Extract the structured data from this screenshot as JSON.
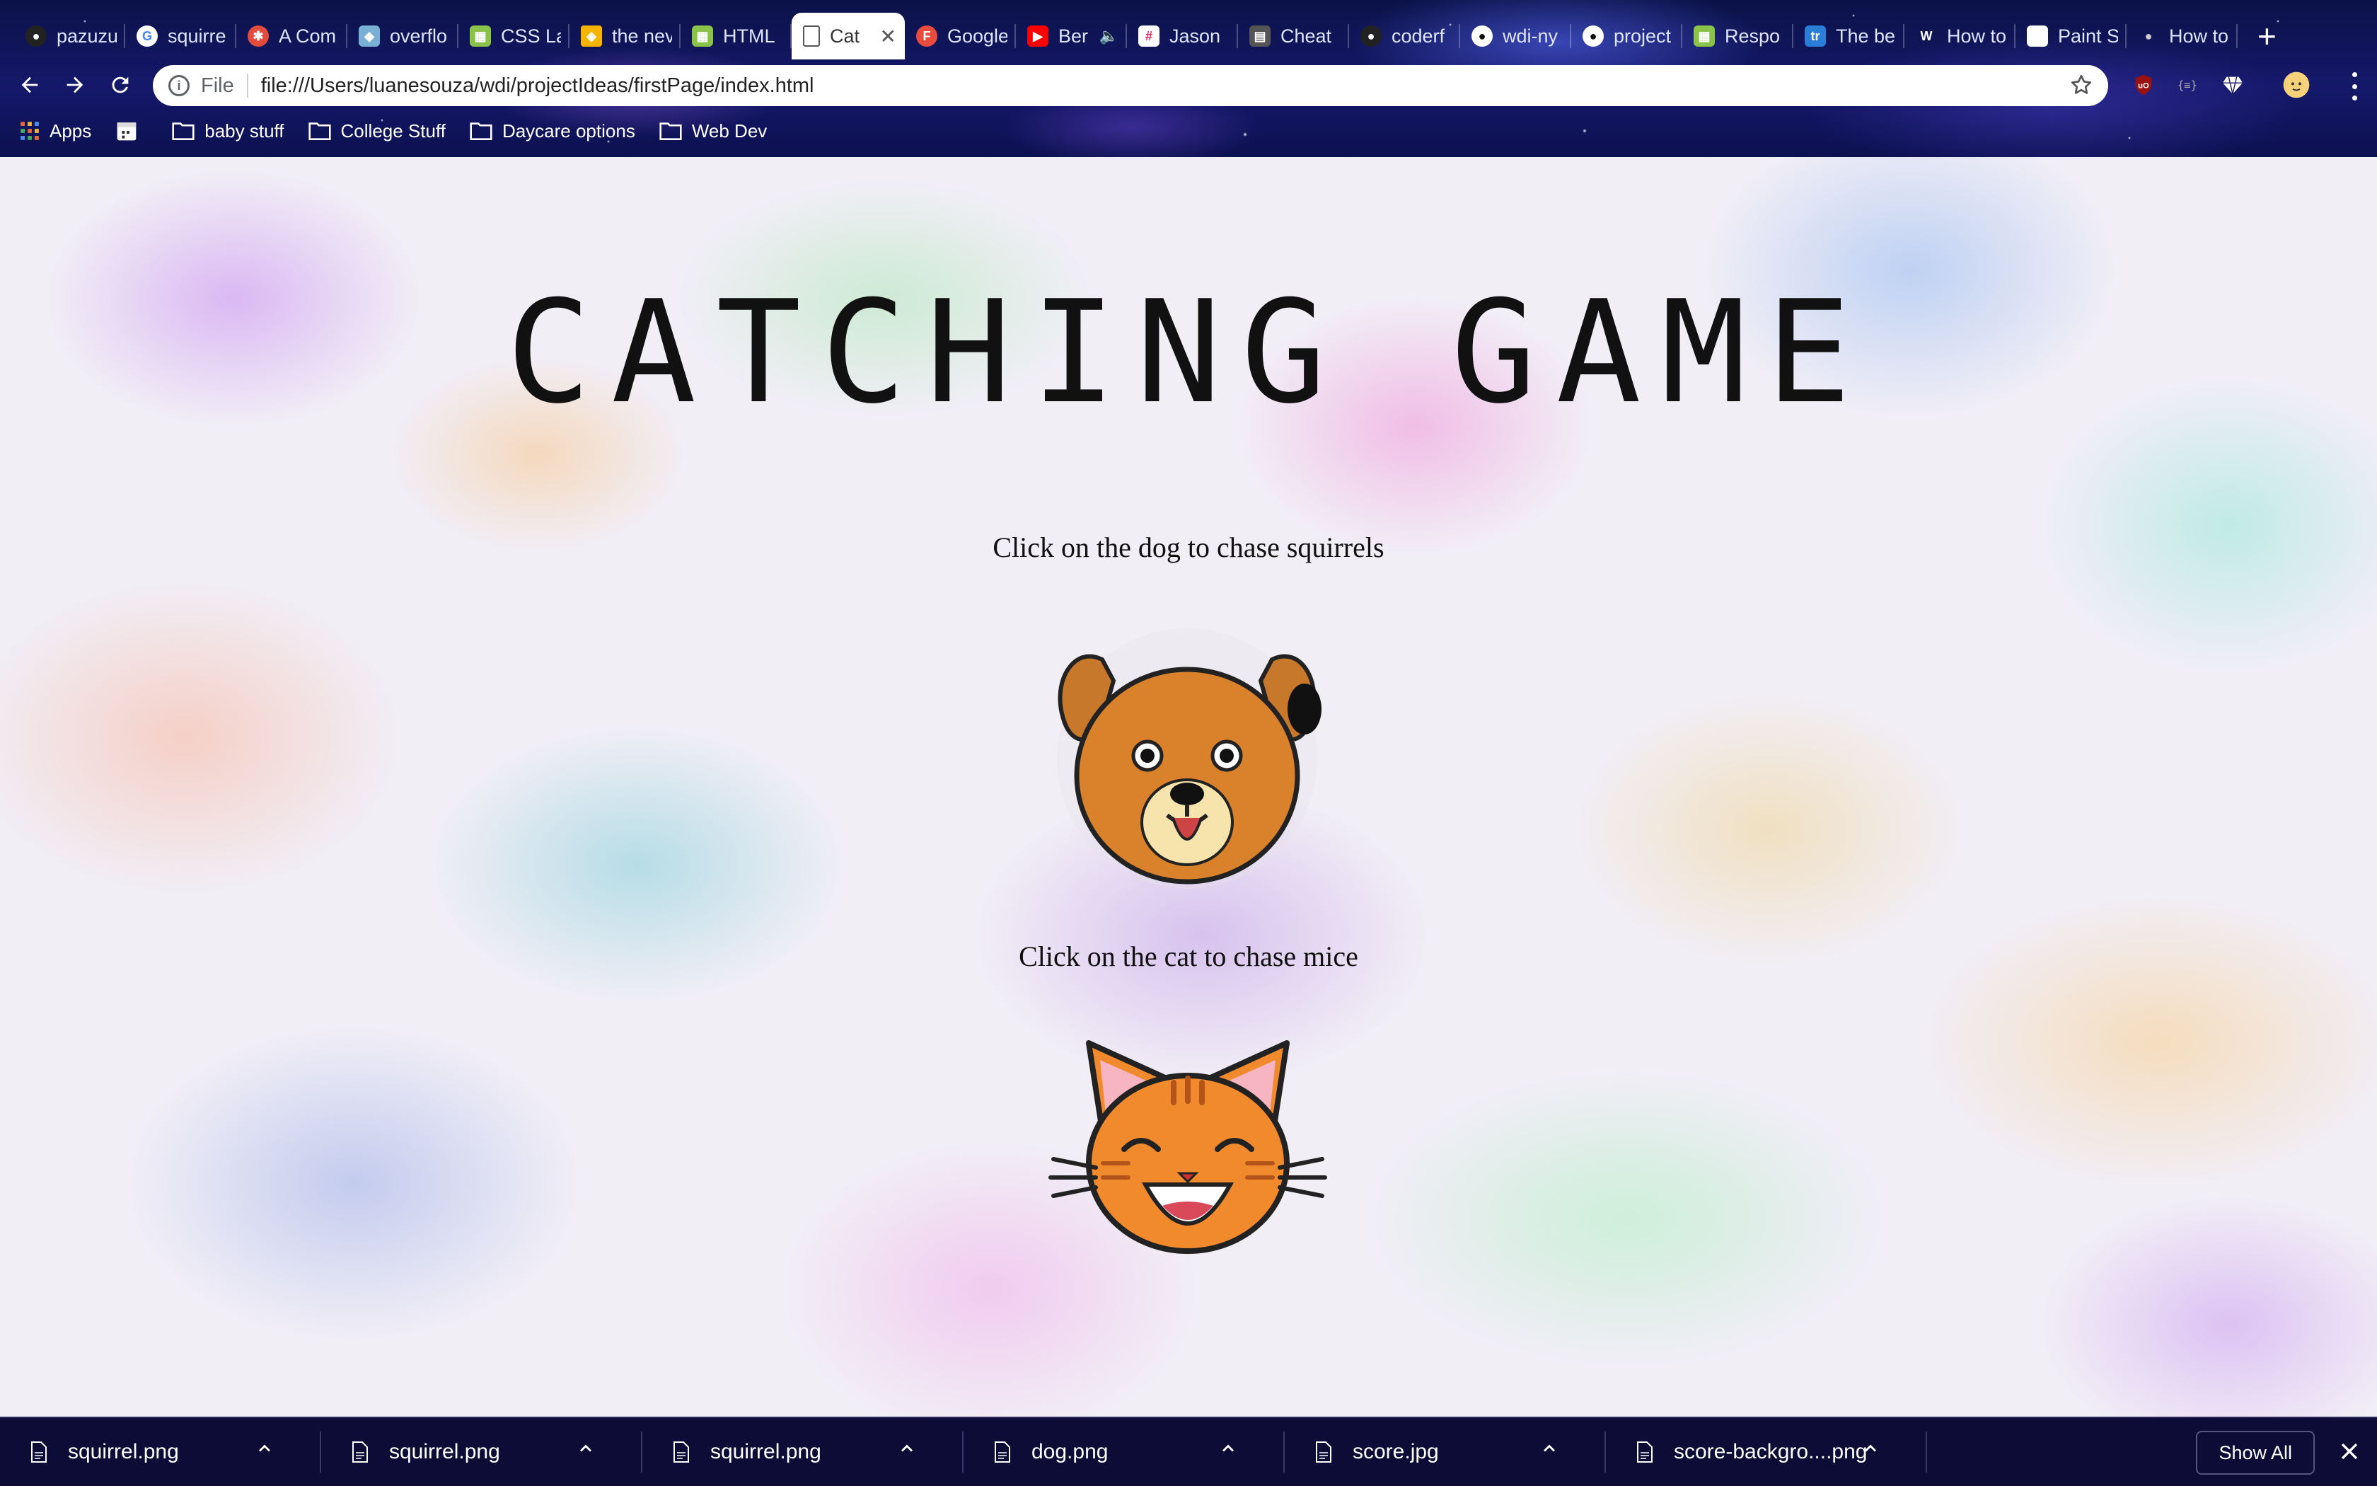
{
  "tabs": [
    {
      "label": "pazuzu",
      "icon": "github-icon",
      "color": "#222222"
    },
    {
      "label": "squirre",
      "icon": "google-icon",
      "color": "#ffffff"
    },
    {
      "label": "A Com",
      "icon": "compass-icon",
      "color": "#e34c3c"
    },
    {
      "label": "overflo",
      "icon": "bird-icon",
      "color": "#7ab0d6"
    },
    {
      "label": "CSS La",
      "icon": "gauge-icon",
      "color": "#8bc34a"
    },
    {
      "label": "the nev",
      "icon": "layers-icon",
      "color": "#f4b400"
    },
    {
      "label": "HTML",
      "icon": "gauge-icon",
      "color": "#8bc34a"
    },
    {
      "label": "Cat",
      "icon": "page-icon",
      "color": "#ffffff",
      "active": true
    },
    {
      "label": "Google",
      "icon": "forms-icon",
      "color": "#e94b3c"
    },
    {
      "label": "Ber",
      "icon": "youtube-icon",
      "color": "#ff0000"
    },
    {
      "label": "Jason",
      "icon": "slack-icon",
      "color": "#ffffff"
    },
    {
      "label": "Cheat",
      "icon": "sheet-icon",
      "color": "#888888"
    },
    {
      "label": "coderf",
      "icon": "github-icon",
      "color": "#222222"
    },
    {
      "label": "wdi-ny",
      "icon": "github-icon",
      "color": "#ffffff"
    },
    {
      "label": "project",
      "icon": "github-icon",
      "color": "#ffffff"
    },
    {
      "label": "Respo",
      "icon": "gauge-icon",
      "color": "#8bc34a"
    },
    {
      "label": "The be",
      "icon": "trello-icon",
      "color": "#2a7ed8"
    },
    {
      "label": "How to",
      "icon": "wix-icon",
      "color": "#ffffff"
    },
    {
      "label": "Paint S",
      "icon": "apple-icon",
      "color": "#ffffff"
    },
    {
      "label": "How to",
      "icon": "apple-icon",
      "color": "#cccccc"
    }
  ],
  "omnibox": {
    "scheme": "File",
    "url": "file:///Users/luanesouza/wdi/projectIdeas/firstPage/index.html"
  },
  "bookmarks": [
    {
      "label": "Apps",
      "icon": "apps-grid-icon"
    },
    {
      "label": "",
      "icon": "calendar-icon"
    },
    {
      "label": "baby stuff",
      "icon": "folder-icon"
    },
    {
      "label": "College Stuff",
      "icon": "folder-icon"
    },
    {
      "label": "Daycare options",
      "icon": "folder-icon"
    },
    {
      "label": "Web Dev",
      "icon": "folder-icon"
    }
  ],
  "page": {
    "title": "CATCHING GAME",
    "dog_instruction": "Click on the dog to chase squirrels",
    "cat_instruction": "Click on the cat to chase mice"
  },
  "downloads": [
    {
      "name": "squirrel.png"
    },
    {
      "name": "squirrel.png"
    },
    {
      "name": "squirrel.png"
    },
    {
      "name": "dog.png"
    },
    {
      "name": "score.jpg"
    },
    {
      "name": "score-backgro....png"
    }
  ],
  "shelf": {
    "show_all": "Show All"
  },
  "colors": {
    "accent_dog": "#d9822b",
    "accent_cat": "#f08a2c",
    "chrome_bg": "#0b1248",
    "shelf_bg": "#0c0c36"
  }
}
